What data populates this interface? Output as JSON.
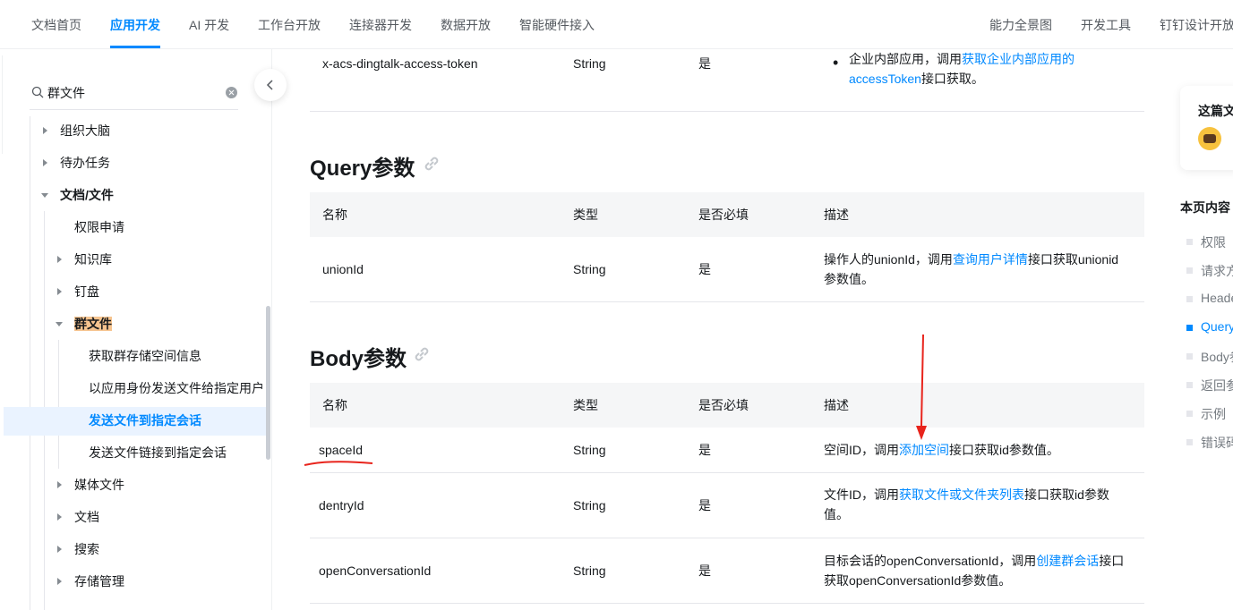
{
  "topnav": {
    "left": [
      "文档首页",
      "应用开发",
      "AI 开发",
      "工作台开放",
      "连接器开发",
      "数据开放",
      "智能硬件接入"
    ],
    "right": [
      "能力全景图",
      "开发工具",
      "钉钉设计开放"
    ]
  },
  "sidebar": {
    "search_value": "群文件",
    "items": [
      {
        "label": "组织大脑"
      },
      {
        "label": "待办任务"
      },
      {
        "label": "文档/文件"
      },
      {
        "label": "权限申请"
      },
      {
        "label": "知识库"
      },
      {
        "label": "钉盘"
      },
      {
        "label": "群文件"
      },
      {
        "label": "获取群存储空间信息"
      },
      {
        "label": "以应用身份发送文件给指定用户"
      },
      {
        "label": "发送文件到指定会话"
      },
      {
        "label": "发送文件链接到指定会话"
      },
      {
        "label": "媒体文件"
      },
      {
        "label": "文档"
      },
      {
        "label": "搜索"
      },
      {
        "label": "存储管理"
      }
    ]
  },
  "header_row": {
    "name": "x-acs-dingtalk-access-token",
    "type": "String",
    "required": "是",
    "desc_bullet_prefix": "企业内部应用，调用",
    "desc_link": "获取企业内部应用的accessToken",
    "desc_suffix": "接口获取。"
  },
  "query_section": {
    "title": "Query参数",
    "columns": [
      "名称",
      "类型",
      "是否必填",
      "描述"
    ],
    "rows": [
      {
        "name": "unionId",
        "type": "String",
        "required": "是",
        "desc_prefix": "操作人的unionId，调用",
        "desc_link": "查询用户详情",
        "desc_suffix": "接口获取unionid参数值。"
      }
    ]
  },
  "body_section": {
    "title": "Body参数",
    "columns": [
      "名称",
      "类型",
      "是否必填",
      "描述"
    ],
    "rows": [
      {
        "name": "spaceId",
        "type": "String",
        "required": "是",
        "desc_prefix": "空间ID，调用",
        "desc_link": "添加空间",
        "desc_suffix": "接口获取id参数值。"
      },
      {
        "name": "dentryId",
        "type": "String",
        "required": "是",
        "desc_prefix": "文件ID，调用",
        "desc_link": "获取文件或文件夹列表",
        "desc_suffix": "接口获取id参数值。"
      },
      {
        "name": "openConversationId",
        "type": "String",
        "required": "是",
        "desc_prefix": "目标会话的openConversationId，调用",
        "desc_link": "创建群会话",
        "desc_suffix": "接口获取openConversationId参数值。"
      }
    ]
  },
  "feedback_card": {
    "title": "这篇文"
  },
  "toc": {
    "title": "本页内容",
    "items": [
      "权限",
      "请求方",
      "Heade",
      "Query",
      "Body参",
      "返回参",
      "示例",
      "错误码"
    ],
    "active_index": 3
  },
  "colors": {
    "accent": "#0089ff",
    "annotation": "#e8241c",
    "highlight": "#f6c48f"
  }
}
